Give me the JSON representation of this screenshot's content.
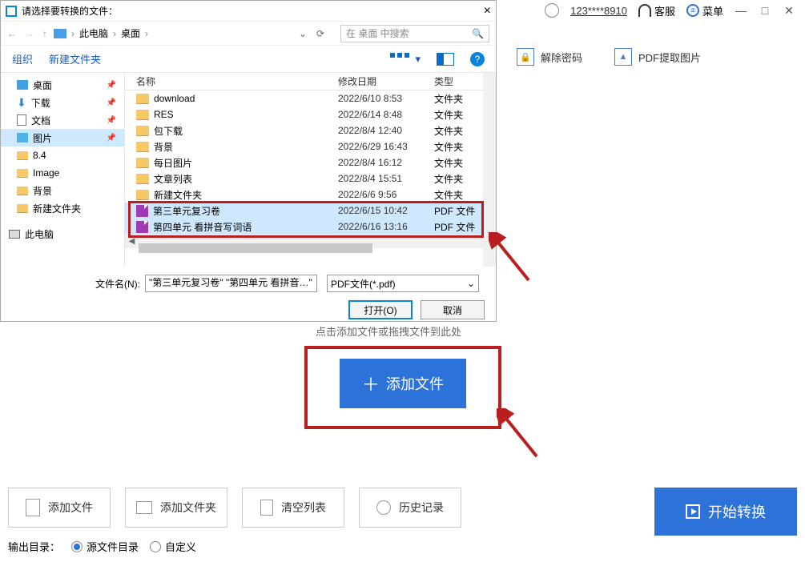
{
  "app": {
    "user_id": "123****8910",
    "support": "客服",
    "menu": "菜单"
  },
  "top_icons": {
    "decrypt": "解除密码",
    "extract_img": "PDF提取图片"
  },
  "dialog": {
    "title": "请选择要转换的文件：",
    "path": {
      "root": "此电脑",
      "folder": "桌面"
    },
    "search_placeholder": "在 桌面 中搜索",
    "toolbar": {
      "organize": "组织",
      "new_folder": "新建文件夹"
    },
    "tree": [
      {
        "label": "桌面",
        "icon": "desk",
        "pin": true
      },
      {
        "label": "下载",
        "icon": "down",
        "pin": true
      },
      {
        "label": "文档",
        "icon": "doc",
        "pin": true
      },
      {
        "label": "图片",
        "icon": "pic",
        "pin": true,
        "selected": true
      },
      {
        "label": "8.4",
        "icon": "fold"
      },
      {
        "label": "Image",
        "icon": "fold"
      },
      {
        "label": "背景",
        "icon": "fold"
      },
      {
        "label": "新建文件夹",
        "icon": "fold"
      }
    ],
    "tree_pc": "此电脑",
    "cols": {
      "name": "名称",
      "date": "修改日期",
      "type": "类型"
    },
    "rows": [
      {
        "name": "download",
        "date": "2022/6/10 8:53",
        "type": "文件夹",
        "kind": "folder"
      },
      {
        "name": "RES",
        "date": "2022/6/14 8:48",
        "type": "文件夹",
        "kind": "folder"
      },
      {
        "name": "包下载",
        "date": "2022/8/4 12:40",
        "type": "文件夹",
        "kind": "folder"
      },
      {
        "name": "背景",
        "date": "2022/6/29 16:43",
        "type": "文件夹",
        "kind": "folder"
      },
      {
        "name": "每日图片",
        "date": "2022/8/4 16:12",
        "type": "文件夹",
        "kind": "folder"
      },
      {
        "name": "文章列表",
        "date": "2022/8/4 15:51",
        "type": "文件夹",
        "kind": "folder"
      },
      {
        "name": "新建文件夹",
        "date": "2022/6/6 9:56",
        "type": "文件夹",
        "kind": "folder"
      },
      {
        "name": "第三单元复习卷",
        "date": "2022/6/15 10:42",
        "type": "PDF 文件",
        "kind": "pdf",
        "selected": true
      },
      {
        "name": "第四单元 看拼音写词语",
        "date": "2022/6/16 13:16",
        "type": "PDF 文件",
        "kind": "pdf",
        "selected": true
      }
    ],
    "filename_label": "文件名(N):",
    "filename_value": "\"第三单元复习卷\" \"第四单元 看拼音…\"",
    "filter": "PDF文件(*.pdf)",
    "open": "打开(O)",
    "cancel": "取消"
  },
  "drag_hint": "点击添加文件或拖拽文件到此处",
  "add_file": "添加文件",
  "bottom": {
    "add_file": "添加文件",
    "add_folder": "添加文件夹",
    "clear": "清空列表",
    "history": "历史记录",
    "start": "开始转换",
    "out_label": "输出目录：",
    "out_src": "源文件目录",
    "out_custom": "自定义"
  }
}
